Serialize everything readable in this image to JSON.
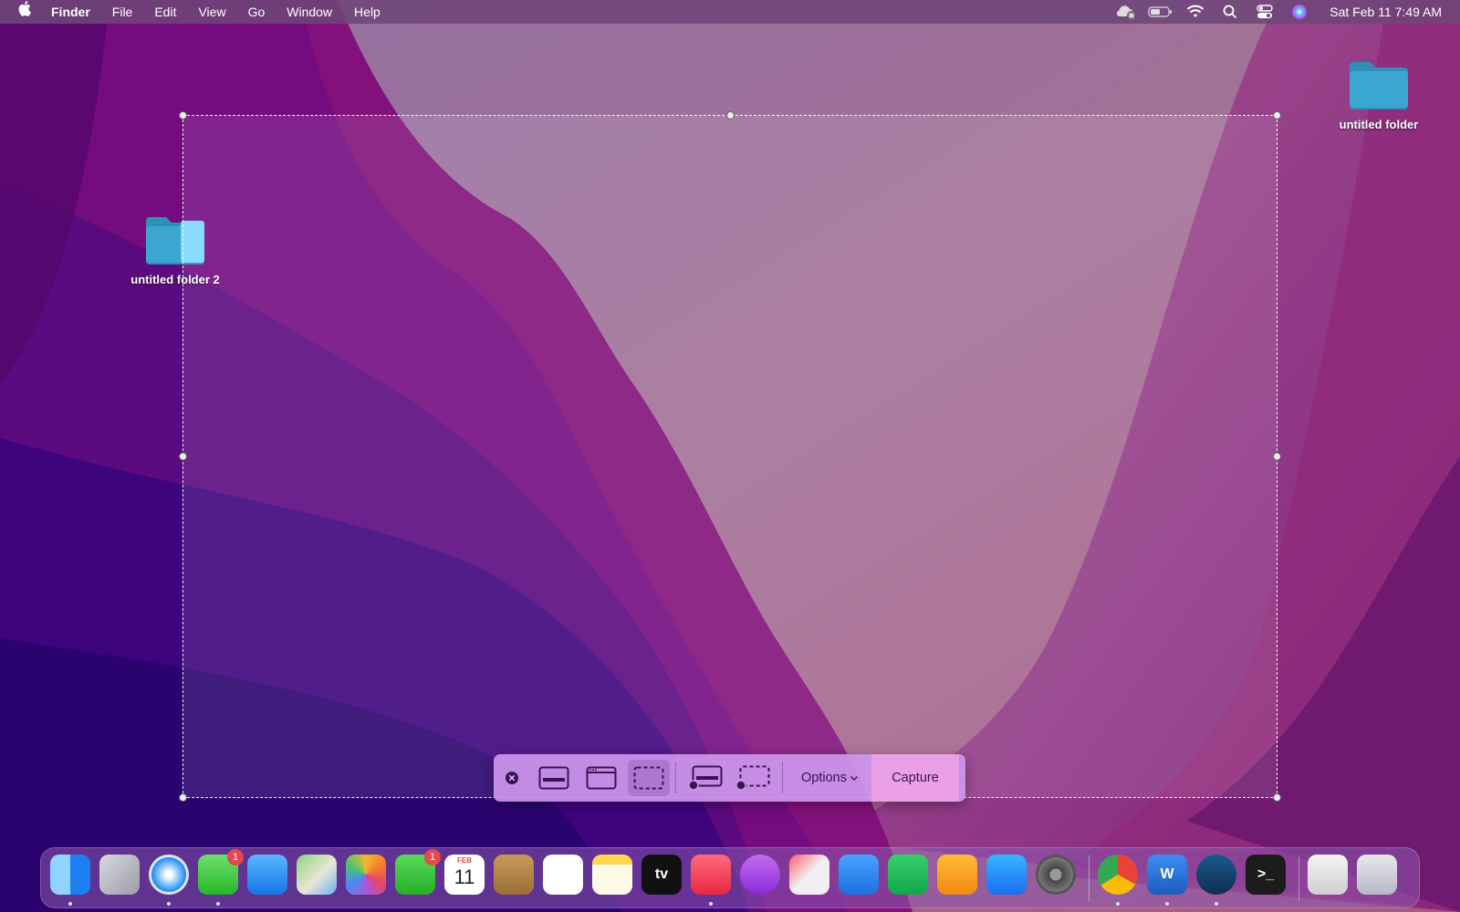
{
  "menubar": {
    "apple_icon": "apple-logo-icon",
    "app_name": "Finder",
    "menus": [
      "File",
      "Edit",
      "View",
      "Go",
      "Window",
      "Help"
    ],
    "status_icons": [
      "icloud-error-icon",
      "battery-icon",
      "wifi-icon",
      "search-icon",
      "control-center-icon",
      "siri-icon"
    ],
    "clock": "Sat Feb 11  7:49 AM"
  },
  "desktop": {
    "icons": [
      {
        "label": "untitled folder",
        "icon": "folder-icon"
      },
      {
        "label": "untitled folder 2",
        "icon": "folder-icon",
        "selected": true
      }
    ]
  },
  "screenshot_toolbar": {
    "close_icon": "close-icon",
    "modes": [
      {
        "name": "capture-entire-screen",
        "icon": "entire-screen-icon",
        "selected": false
      },
      {
        "name": "capture-selected-window",
        "icon": "window-icon",
        "selected": false
      },
      {
        "name": "capture-selected-portion",
        "icon": "selection-icon",
        "selected": true
      },
      {
        "name": "record-entire-screen",
        "icon": "record-screen-icon",
        "selected": false
      },
      {
        "name": "record-selected-portion",
        "icon": "record-selection-icon",
        "selected": false
      }
    ],
    "options_label": "Options",
    "capture_label": "Capture"
  },
  "dock": {
    "apps": [
      {
        "name": "Finder",
        "icon": "finder-icon",
        "running": true
      },
      {
        "name": "Launchpad",
        "icon": "launchpad-icon",
        "running": false
      },
      {
        "name": "Safari",
        "icon": "safari-icon",
        "running": true
      },
      {
        "name": "Messages",
        "icon": "messages-icon",
        "running": true,
        "badge": "1"
      },
      {
        "name": "Mail",
        "icon": "mail-icon",
        "running": false
      },
      {
        "name": "Maps",
        "icon": "maps-icon",
        "running": false
      },
      {
        "name": "Photos",
        "icon": "photos-icon",
        "running": false
      },
      {
        "name": "FaceTime",
        "icon": "facetime-icon",
        "running": false,
        "badge": "1"
      },
      {
        "name": "Calendar",
        "icon": "calendar-icon",
        "running": false,
        "month": "FEB",
        "day": "11"
      },
      {
        "name": "Contacts",
        "icon": "contacts-icon",
        "running": false
      },
      {
        "name": "Reminders",
        "icon": "reminders-icon",
        "running": false
      },
      {
        "name": "Notes",
        "icon": "notes-icon",
        "running": false
      },
      {
        "name": "TV",
        "icon": "apple-tv-icon",
        "running": false,
        "text": "tv"
      },
      {
        "name": "Music",
        "icon": "music-icon",
        "running": true
      },
      {
        "name": "Podcasts",
        "icon": "podcasts-icon",
        "running": false
      },
      {
        "name": "News",
        "icon": "news-icon",
        "running": false
      },
      {
        "name": "Keynote",
        "icon": "keynote-icon",
        "running": false
      },
      {
        "name": "Numbers",
        "icon": "numbers-icon",
        "running": false
      },
      {
        "name": "Pages",
        "icon": "pages-icon",
        "running": false
      },
      {
        "name": "App Store",
        "icon": "app-store-icon",
        "running": false
      },
      {
        "name": "System Preferences",
        "icon": "system-preferences-icon",
        "running": false
      },
      {
        "name": "Google Chrome",
        "icon": "chrome-icon",
        "running": true
      },
      {
        "name": "Microsoft Word",
        "icon": "word-icon",
        "running": true,
        "text": "W"
      },
      {
        "name": "Steam",
        "icon": "steam-icon",
        "running": true
      },
      {
        "name": "Terminal",
        "icon": "terminal-icon",
        "running": false,
        "text": ">_"
      },
      {
        "name": "Downloads",
        "icon": "downloads-stack-icon",
        "running": false
      },
      {
        "name": "Trash",
        "icon": "trash-icon",
        "running": false
      }
    ]
  }
}
